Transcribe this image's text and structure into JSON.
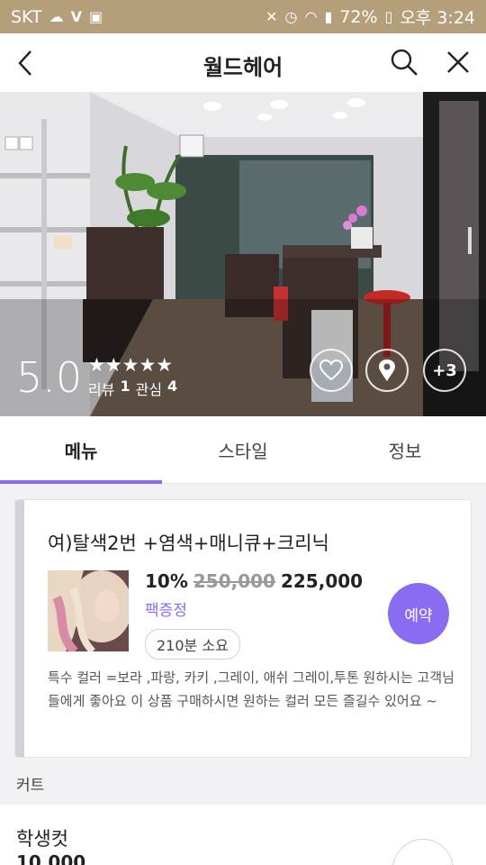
{
  "status_bar": {
    "carrier": "SKT",
    "battery": "72%",
    "time": "오후 3:24"
  },
  "header": {
    "title": "월드헤어"
  },
  "hero": {
    "rating": "5.0",
    "stars": "★★★★★",
    "review_label": "리뷰",
    "review_count": "1",
    "interest_label": "관심",
    "interest_count": "4",
    "more_photos": "+3"
  },
  "tabs": [
    {
      "label": "메뉴"
    },
    {
      "label": "스타일"
    },
    {
      "label": "정보"
    }
  ],
  "menu_item": {
    "name": "여)탈색2번 +염색+매니큐+크리닉",
    "discount": "10%",
    "original_price": "250,000",
    "price": "225,000",
    "pack": "팩증정",
    "duration": "210분 소요",
    "book_label": "예약",
    "description": "특수 컬러 =보라 ,파랑, 카키 ,그레이, 애쉬 그레이,투톤 원하시는 고객님들에게 좋아요  이 상품 구매하시면 원하는 컬러 모든 즐길수 있어요 ~"
  },
  "section": {
    "label": "커트"
  },
  "menu_item_2": {
    "name": "학생컷",
    "price": "10,000"
  },
  "colors": {
    "accent": "#8a6cf2",
    "status_bar": "#b49f7a"
  }
}
